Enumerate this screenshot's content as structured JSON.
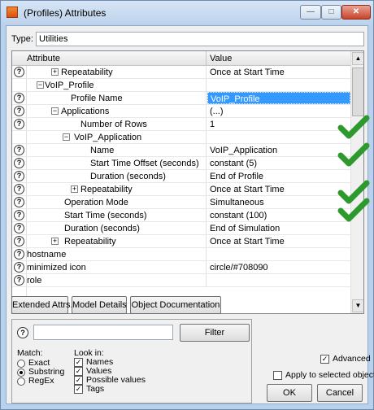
{
  "window": {
    "title": "(Profiles) Attributes"
  },
  "type_row": {
    "label": "Type:",
    "value": "Utilities"
  },
  "grid": {
    "headers": {
      "attribute": "Attribute",
      "value": "Value"
    },
    "rows": [
      {
        "name": "Repeatability",
        "value": "Once at Start Time",
        "toggle": "+"
      },
      {
        "name": "VoIP_Profile",
        "value": "",
        "toggle": "−"
      },
      {
        "name": "Profile Name",
        "value": "VoIP_Profile"
      },
      {
        "name": "Applications",
        "value": "(...)",
        "toggle": "−"
      },
      {
        "name": "Number of Rows",
        "value": "1"
      },
      {
        "name": "VoIP_Application",
        "value": "",
        "toggle": "−"
      },
      {
        "name": "Name",
        "value": "VoIP_Application"
      },
      {
        "name": "Start Time Offset (seconds)",
        "value": "constant (5)"
      },
      {
        "name": "Duration (seconds)",
        "value": "End of Profile"
      },
      {
        "name": "Repeatability",
        "value": "Once at Start Time",
        "toggle": "+"
      },
      {
        "name": "Operation Mode",
        "value": "Simultaneous"
      },
      {
        "name": "Start Time (seconds)",
        "value": "constant (100)"
      },
      {
        "name": "Duration (seconds)",
        "value": "End of Simulation"
      },
      {
        "name": "Repeatability",
        "value": "Once at Start Time",
        "toggle": "+"
      },
      {
        "name": "hostname",
        "value": ""
      },
      {
        "name": "minimized icon",
        "value": "circle/#708090"
      },
      {
        "name": "role",
        "value": ""
      }
    ],
    "help_icon": "?"
  },
  "buttons": {
    "extended": "Extended Attrs.",
    "model_details": "Model Details",
    "object_doc": "Object Documentation",
    "filter": "Filter",
    "ok": "OK",
    "cancel": "Cancel"
  },
  "filter_panel": {
    "match_label": "Match:",
    "match_options": [
      "Exact",
      "Substring",
      "RegEx"
    ],
    "selected_match": "Substring",
    "look_in_label": "Look in:",
    "look_in_options": [
      "Names",
      "Values",
      "Possible values",
      "Tags"
    ]
  },
  "options": {
    "advanced": "Advanced",
    "apply_selected": "Apply to selected objects"
  },
  "colors": {
    "selection": "#3399ff",
    "check_green": "#2e9a2e"
  }
}
